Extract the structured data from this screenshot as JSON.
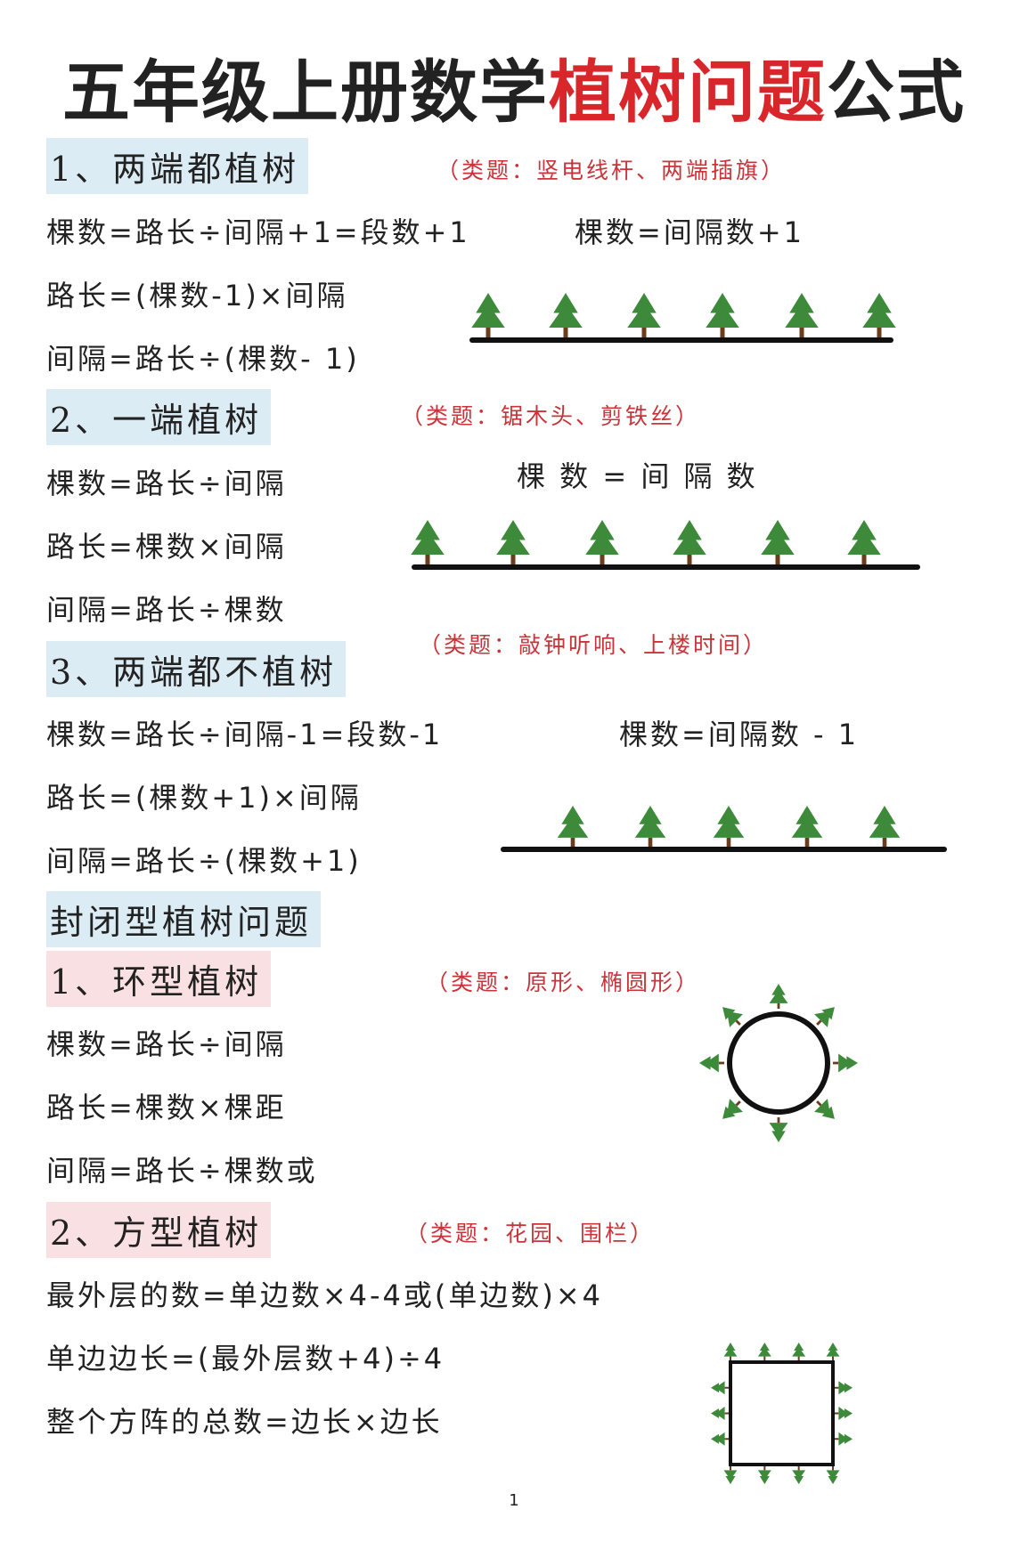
{
  "title": {
    "part1": "五年级上册数学",
    "part2": "植树问题",
    "part3": "公式"
  },
  "colors": {
    "accent": "#d8262b",
    "tree": "#3d8a3a",
    "trunk": "#6b3d1c",
    "blue_band": "#dcecf4",
    "pink_band": "#f9e1e3"
  },
  "s1": {
    "header": "1、两端都植树",
    "note": "（类题：竖电线杆、两端插旗）",
    "f1": "棵数=路长÷间隔+1=段数+1",
    "f_right": "棵数=间隔数+1",
    "f2": "路长=(棵数-1)×间隔",
    "f3": "间隔=路长÷(棵数- 1)"
  },
  "s2": {
    "header": "2、一端植树",
    "note": "（类题：锯木头、剪铁丝）",
    "f1": "棵数=路长÷间隔",
    "f_right": "棵 数 = 间 隔 数",
    "f2": "路长=棵数×间隔",
    "f3": "间隔=路长÷棵数"
  },
  "s3": {
    "header": "3、两端都不植树",
    "note": "（类题：敲钟听响、上楼时间）",
    "f1": "棵数=路长÷间隔-1=段数-1",
    "f_right": "棵数=间隔数  -  1",
    "f2": "路长=(棵数+1)×间隔",
    "f3": "间隔=路长÷(棵数+1)"
  },
  "closed": {
    "header": "封闭型植树问题"
  },
  "c1": {
    "header": "1、环型植树",
    "note": "（类题：原形、椭圆形）",
    "f1": "棵数=路长÷间隔",
    "f2": "路长=棵数×棵距",
    "f3": "间隔=路长÷棵数或"
  },
  "c2": {
    "header": "2、方型植树",
    "note": "（类题：花园、围栏）",
    "f1": "最外层的数=单边数×4-4或(单边数)×4",
    "f2": "单边边长=(最外层数+4)÷4",
    "f3": "整个方阵的总数=边长×边长"
  },
  "page_number": "1"
}
